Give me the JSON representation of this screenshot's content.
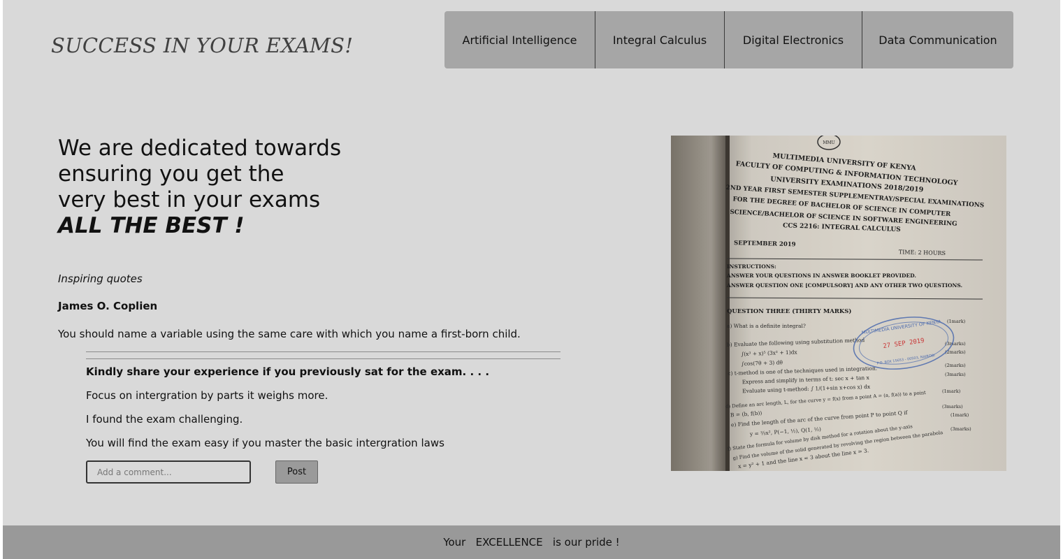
{
  "header": {
    "brand": "SUCCESS IN YOUR EXAMS!",
    "nav": [
      {
        "label": "Artificial Intelligence"
      },
      {
        "label": "Integral Calculus"
      },
      {
        "label": "Digital Electronics"
      },
      {
        "label": "Data Communication"
      }
    ]
  },
  "hero": {
    "line1": "We are dedicated towards",
    "line2": "ensuring you get the",
    "line3": "very best in your exams",
    "emphasis": "ALL THE BEST !"
  },
  "quotes": {
    "label": "Inspiring quotes",
    "author": "James O. Coplien",
    "text": "You should name a variable using the same care with which you name a first-born child."
  },
  "experience": {
    "heading": "Kindly share your experience if you previously sat for the exam. . . .",
    "comments": [
      "Focus on intergration by parts it weighs more.",
      "I found the exam challenging.",
      "You will find the exam easy if you master the basic intergration laws"
    ],
    "input_placeholder": "Add a comment...",
    "post_label": "Post"
  },
  "photo": {
    "university": "MULTIMEDIA UNIVERSITY OF KENYA",
    "faculty": "FACULTY OF COMPUTING & INFORMATION TECHNOLOGY",
    "exams": "UNIVERSITY EXAMINATIONS 2018/2019",
    "semester": "2ND YEAR FIRST SEMESTER SUPPLEMENTRAY/SPECIAL EXAMINATIONS",
    "degree1": "FOR THE DEGREE OF BACHELOR OF SCIENCE IN COMPUTER",
    "degree2": "SCIENCE/BACHELOR OF SCIENCE IN SOFTWARE ENGINEERING",
    "course": "CCS 2216: INTEGRAL CALCULUS",
    "date": "SEPTEMBER 2019",
    "time": "TIME: 2 HOURS",
    "instructions": "INSTRUCTIONS:",
    "instr1": "ANSWER YOUR QUESTIONS IN ANSWER BOOKLET PROVIDED.",
    "instr2": "ANSWER QUESTION ONE [COMPULSORY] AND ANY OTHER TWO QUESTIONS.",
    "section": "QUESTION THREE (THIRTY MARKS)",
    "q1": "a) What is a definite integral?",
    "q1m": "(1mark)",
    "q2": "b) Evaluate the following using substitution method",
    "q2a": "∫(x³ + x)⁵ (3x² + 1)dx",
    "q2am": "(3marks)",
    "q2b": "∫cos(7θ + 3) dθ",
    "q2bm": "(2marks)",
    "q3": "c) t-method is one of the techniques used in integration.",
    "q3m": "(2marks)",
    "q3a": "Express and simplify in terms of t:   sec x + tan x",
    "q3am": "(3marks)",
    "q3b": "Evaluate using t-method: ∫ 1/(1+sin x+cos x) dx",
    "q4": "d) Define an arc length, L, for the curve y = f(x) from a point A = (a, f(a)) to a point",
    "q4a": "B = (b, f(b))",
    "q4m": "(1mark)",
    "q5": "e) Find the length of the arc of the curve from point P to point Q if",
    "q5a": "y = ⅔x²,        P(−1, ½),        Q(1, ½)",
    "q5m": "(3marks)",
    "q6": "f) State the formula for volume by disk method for a rotation about the y-axis",
    "q6m": "(1mark)",
    "q7": "g) Find the volume of the solid generated by revolving the region between the parabola",
    "q7a": "x = y² + 1 and the line x = 3 about the line x = 3.",
    "q7m": "(3marks)",
    "stamp_top": "MULTIMEDIA UNIVERSITY OF KENYA",
    "stamp_date": "27 SEP 2019",
    "stamp_bottom": "P.O. BOX 15653 - 00503, NAIROBI",
    "logo_text": "MMU"
  },
  "footer": {
    "text": "Your   EXCELLENCE   is our pride !"
  },
  "colors": {
    "background": "#d9d9d9",
    "nav": "#a6a6a6",
    "footer": "#999999",
    "stamp_red": "#d23a3a",
    "stamp_blue": "#4f6fb5"
  }
}
